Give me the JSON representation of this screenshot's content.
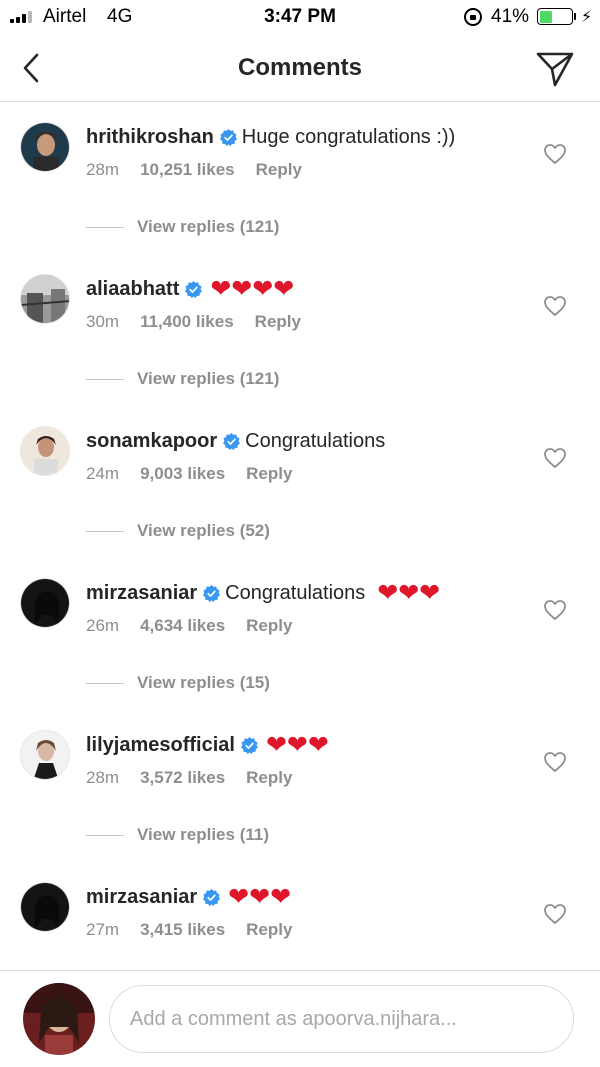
{
  "status_bar": {
    "carrier": "Airtel",
    "network": "4G",
    "time": "3:47 PM",
    "battery_percent": "41%",
    "battery_level": 0.41,
    "signal_bars": 3,
    "signal_max": 4
  },
  "header": {
    "title": "Comments"
  },
  "colors": {
    "verified": "#3897f0",
    "meta_text": "#8e8e8e",
    "heart_emoji": "#e0162b",
    "battery_fill": "#4cd964"
  },
  "comments": [
    {
      "username": "hrithikroshan",
      "verified": true,
      "text": "Huge congratulations :))",
      "hearts": "",
      "time": "28m",
      "likes": "10,251 likes",
      "reply_label": "Reply",
      "view_replies": "View replies (121)"
    },
    {
      "username": "aliaabhatt",
      "verified": true,
      "text": "",
      "hearts": "❤❤❤❤",
      "time": "30m",
      "likes": "11,400 likes",
      "reply_label": "Reply",
      "view_replies": "View replies (121)"
    },
    {
      "username": "sonamkapoor",
      "verified": true,
      "text": "Congratulations",
      "hearts": "",
      "time": "24m",
      "likes": "9,003 likes",
      "reply_label": "Reply",
      "view_replies": "View replies (52)"
    },
    {
      "username": "mirzasaniar",
      "verified": true,
      "text": "Congratulations",
      "hearts": "❤❤❤",
      "time": "26m",
      "likes": "4,634 likes",
      "reply_label": "Reply",
      "view_replies": "View replies (15)"
    },
    {
      "username": "lilyjamesofficial",
      "verified": true,
      "text": "",
      "hearts": "❤❤❤",
      "time": "28m",
      "likes": "3,572 likes",
      "reply_label": "Reply",
      "view_replies": "View replies (11)"
    },
    {
      "username": "mirzasaniar",
      "verified": true,
      "text": "",
      "hearts": "❤❤❤",
      "time": "27m",
      "likes": "3,415 likes",
      "reply_label": "Reply",
      "view_replies": ""
    }
  ],
  "composer": {
    "placeholder": "Add a comment as apoorva.nijhara..."
  }
}
